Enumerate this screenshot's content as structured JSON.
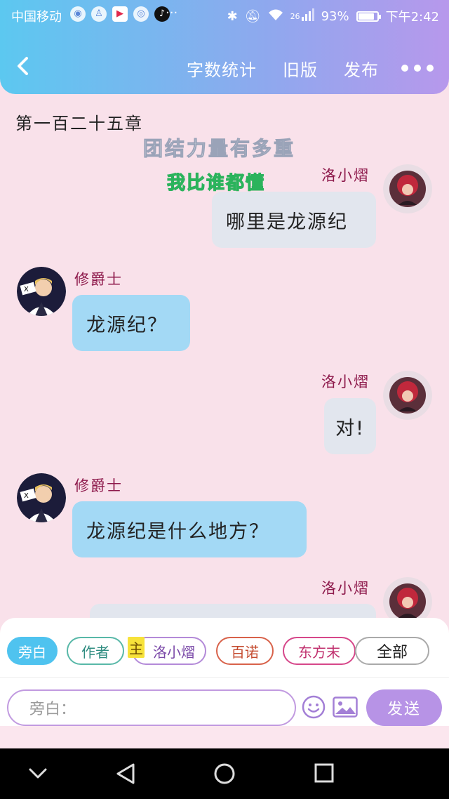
{
  "status_bar": {
    "carrier": "中国移动",
    "app_icons": [
      "globe-icon",
      "qq-icon",
      "youku-icon",
      "browser-icon",
      "tiktok-icon"
    ],
    "more": "···",
    "network": "26",
    "battery": "93%",
    "battery_level": 0.93,
    "time": "下午2:42"
  },
  "app_bar": {
    "word_count": "字数统计",
    "old_version": "旧版",
    "publish": "发布"
  },
  "chapter_title": "第一百二十五章",
  "decorations": {
    "line1": "团结力量有多重",
    "line2": "我比谁都懂"
  },
  "messages": [
    {
      "side": "right",
      "speaker": "洛小熠",
      "text": "哪里是龙源纪"
    },
    {
      "side": "left",
      "speaker": "修爵士",
      "text": "龙源纪？"
    },
    {
      "side": "right",
      "speaker": "洛小熠",
      "text": "对!"
    },
    {
      "side": "left",
      "speaker": "修爵士",
      "text": "龙源纪是什么地方？"
    },
    {
      "side": "right",
      "speaker": "洛小熠",
      "text": ""
    }
  ],
  "roles": {
    "narration": "旁白",
    "author": "作者",
    "main_tag": "主",
    "luo": "洛小熠",
    "bainuo": "百诺",
    "dong": "东方末",
    "all": "全部"
  },
  "composer": {
    "placeholder": "旁白：",
    "send": "发送"
  },
  "colors": {
    "accent": "#b793e6",
    "bubble_me": "#e2e6ee",
    "bubble_them": "#a3d9f5",
    "background": "#f9e1ea"
  }
}
